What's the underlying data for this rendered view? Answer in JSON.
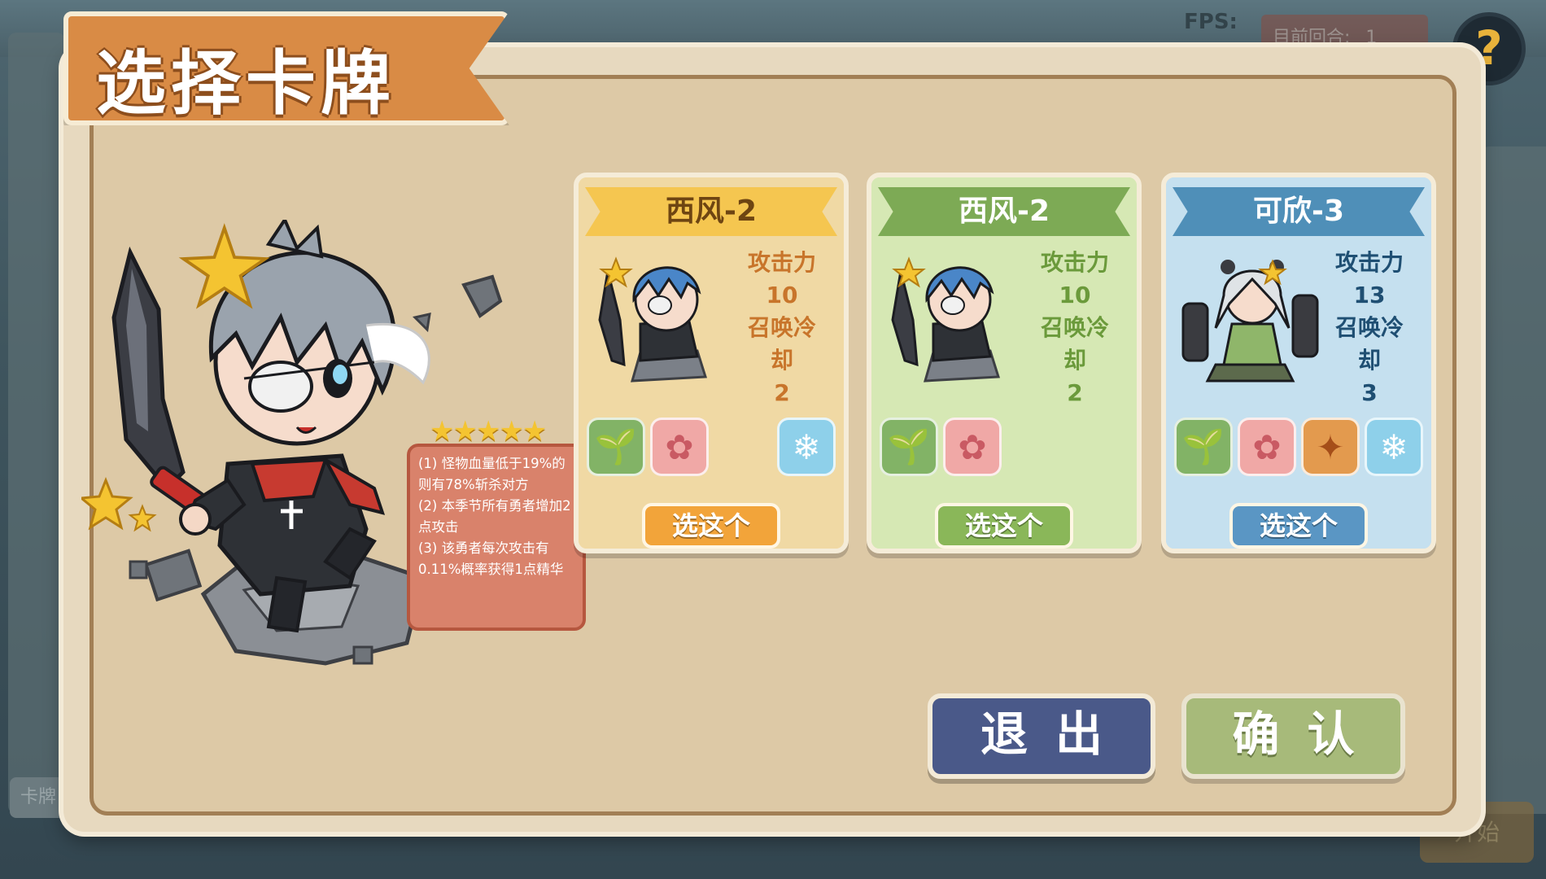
{
  "background": {
    "fps_label": "FPS:",
    "round_label": "目前回合:",
    "round_value": "1",
    "help_icon": "question-mark-icon",
    "left_tab_label": "卡牌",
    "start_label": "开始"
  },
  "modal": {
    "title": "选择卡牌"
  },
  "hero": {
    "stars": "★★★★★",
    "rating": 5,
    "skills": [
      "(1) 怪物血量低于19%的则有78%斩杀对方",
      "(2) 本季节所有勇者增加2点攻击",
      "(3) 该勇者每次攻击有0.11%概率获得1点精华"
    ]
  },
  "cards": [
    {
      "name": "西风-2",
      "attack_label": "攻击力",
      "attack": "10",
      "cooldown_label_1": "召唤冷",
      "cooldown_label_2": "却",
      "cooldown": "2",
      "button": "选这个",
      "theme": "#f5c650",
      "badges": [
        "sprout-icon",
        "lotus-icon",
        "snowflake-icon"
      ]
    },
    {
      "name": "西风-2",
      "attack_label": "攻击力",
      "attack": "10",
      "cooldown_label_1": "召唤冷",
      "cooldown_label_2": "却",
      "cooldown": "2",
      "button": "选这个",
      "theme": "#7daa55",
      "badges": [
        "sprout-icon",
        "lotus-icon"
      ]
    },
    {
      "name": "可欣-3",
      "attack_label": "攻击力",
      "attack": "13",
      "cooldown_label_1": "召唤冷",
      "cooldown_label_2": "却",
      "cooldown": "3",
      "button": "选这个",
      "theme": "#4f8fb8",
      "badges": [
        "sprout-icon",
        "lotus-icon",
        "maple-leaf-icon",
        "snowflake-icon"
      ]
    }
  ],
  "actions": {
    "exit": "退出",
    "confirm": "确认"
  },
  "colors": {
    "panel": "#e7d9bf",
    "banner": "#d98b45",
    "exit": "#4a5989",
    "confirm": "#a7ba7a"
  }
}
